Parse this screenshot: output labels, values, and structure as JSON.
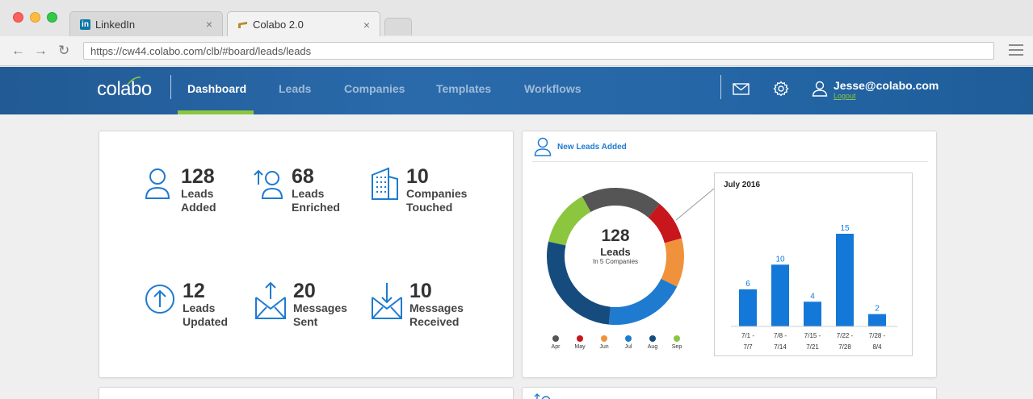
{
  "browser": {
    "tabs": [
      {
        "label": "LinkedIn",
        "icon": "linkedin-icon"
      },
      {
        "label": "Colabo 2.0",
        "icon": "colabo-icon"
      }
    ],
    "url": "https://cw44.colabo.com/clb/#board/leads/leads"
  },
  "app": {
    "logo": "colabo",
    "nav": [
      "Dashboard",
      "Leads",
      "Companies",
      "Templates",
      "Workflows"
    ],
    "active_nav": "Dashboard",
    "user_email": "Jesse@colabo.com",
    "logout_label": "Logout",
    "accent": "#8cc63f",
    "header_color": "#2466a6"
  },
  "stats": [
    {
      "num": "128",
      "line1": "Leads",
      "line2": "Added",
      "icon": "user-icon"
    },
    {
      "num": "68",
      "line1": "Leads",
      "line2": "Enriched",
      "icon": "user-arrow-up-icon"
    },
    {
      "num": "10",
      "line1": "Companies",
      "line2": "Touched",
      "icon": "building-icon"
    },
    {
      "num": "12",
      "line1": "Leads",
      "line2": "Updated",
      "icon": "upload-circle-icon"
    },
    {
      "num": "20",
      "line1": "Messages",
      "line2": "Sent",
      "icon": "envelope-up-icon"
    },
    {
      "num": "10",
      "line1": "Messages",
      "line2": "Received",
      "icon": "envelope-down-icon"
    }
  ],
  "leads_panel": {
    "title": "New Leads Added",
    "center_num": "128",
    "center_label": "Leads",
    "center_sub": "In 5 Companies"
  },
  "chart_data": [
    {
      "type": "pie",
      "categories": [
        "Apr",
        "May",
        "Jun",
        "Jul",
        "Aug",
        "Sep"
      ],
      "values": [
        20,
        10,
        12,
        20,
        28,
        14
      ],
      "colors": [
        "#555555",
        "#c8161d",
        "#f0923b",
        "#1e7bd0",
        "#164c7d",
        "#8cc63f"
      ],
      "title": "",
      "legend": "bottom"
    },
    {
      "type": "bar",
      "title": "July 2016",
      "categories": [
        "7/1 - 7/7",
        "7/8 - 7/14",
        "7/15 - 7/21",
        "7/22 - 7/28",
        "7/28 - 8/4"
      ],
      "values": [
        6,
        10,
        4,
        15,
        2
      ],
      "ylim": [
        0,
        15
      ],
      "grid": false,
      "color": "#1478d8"
    }
  ]
}
